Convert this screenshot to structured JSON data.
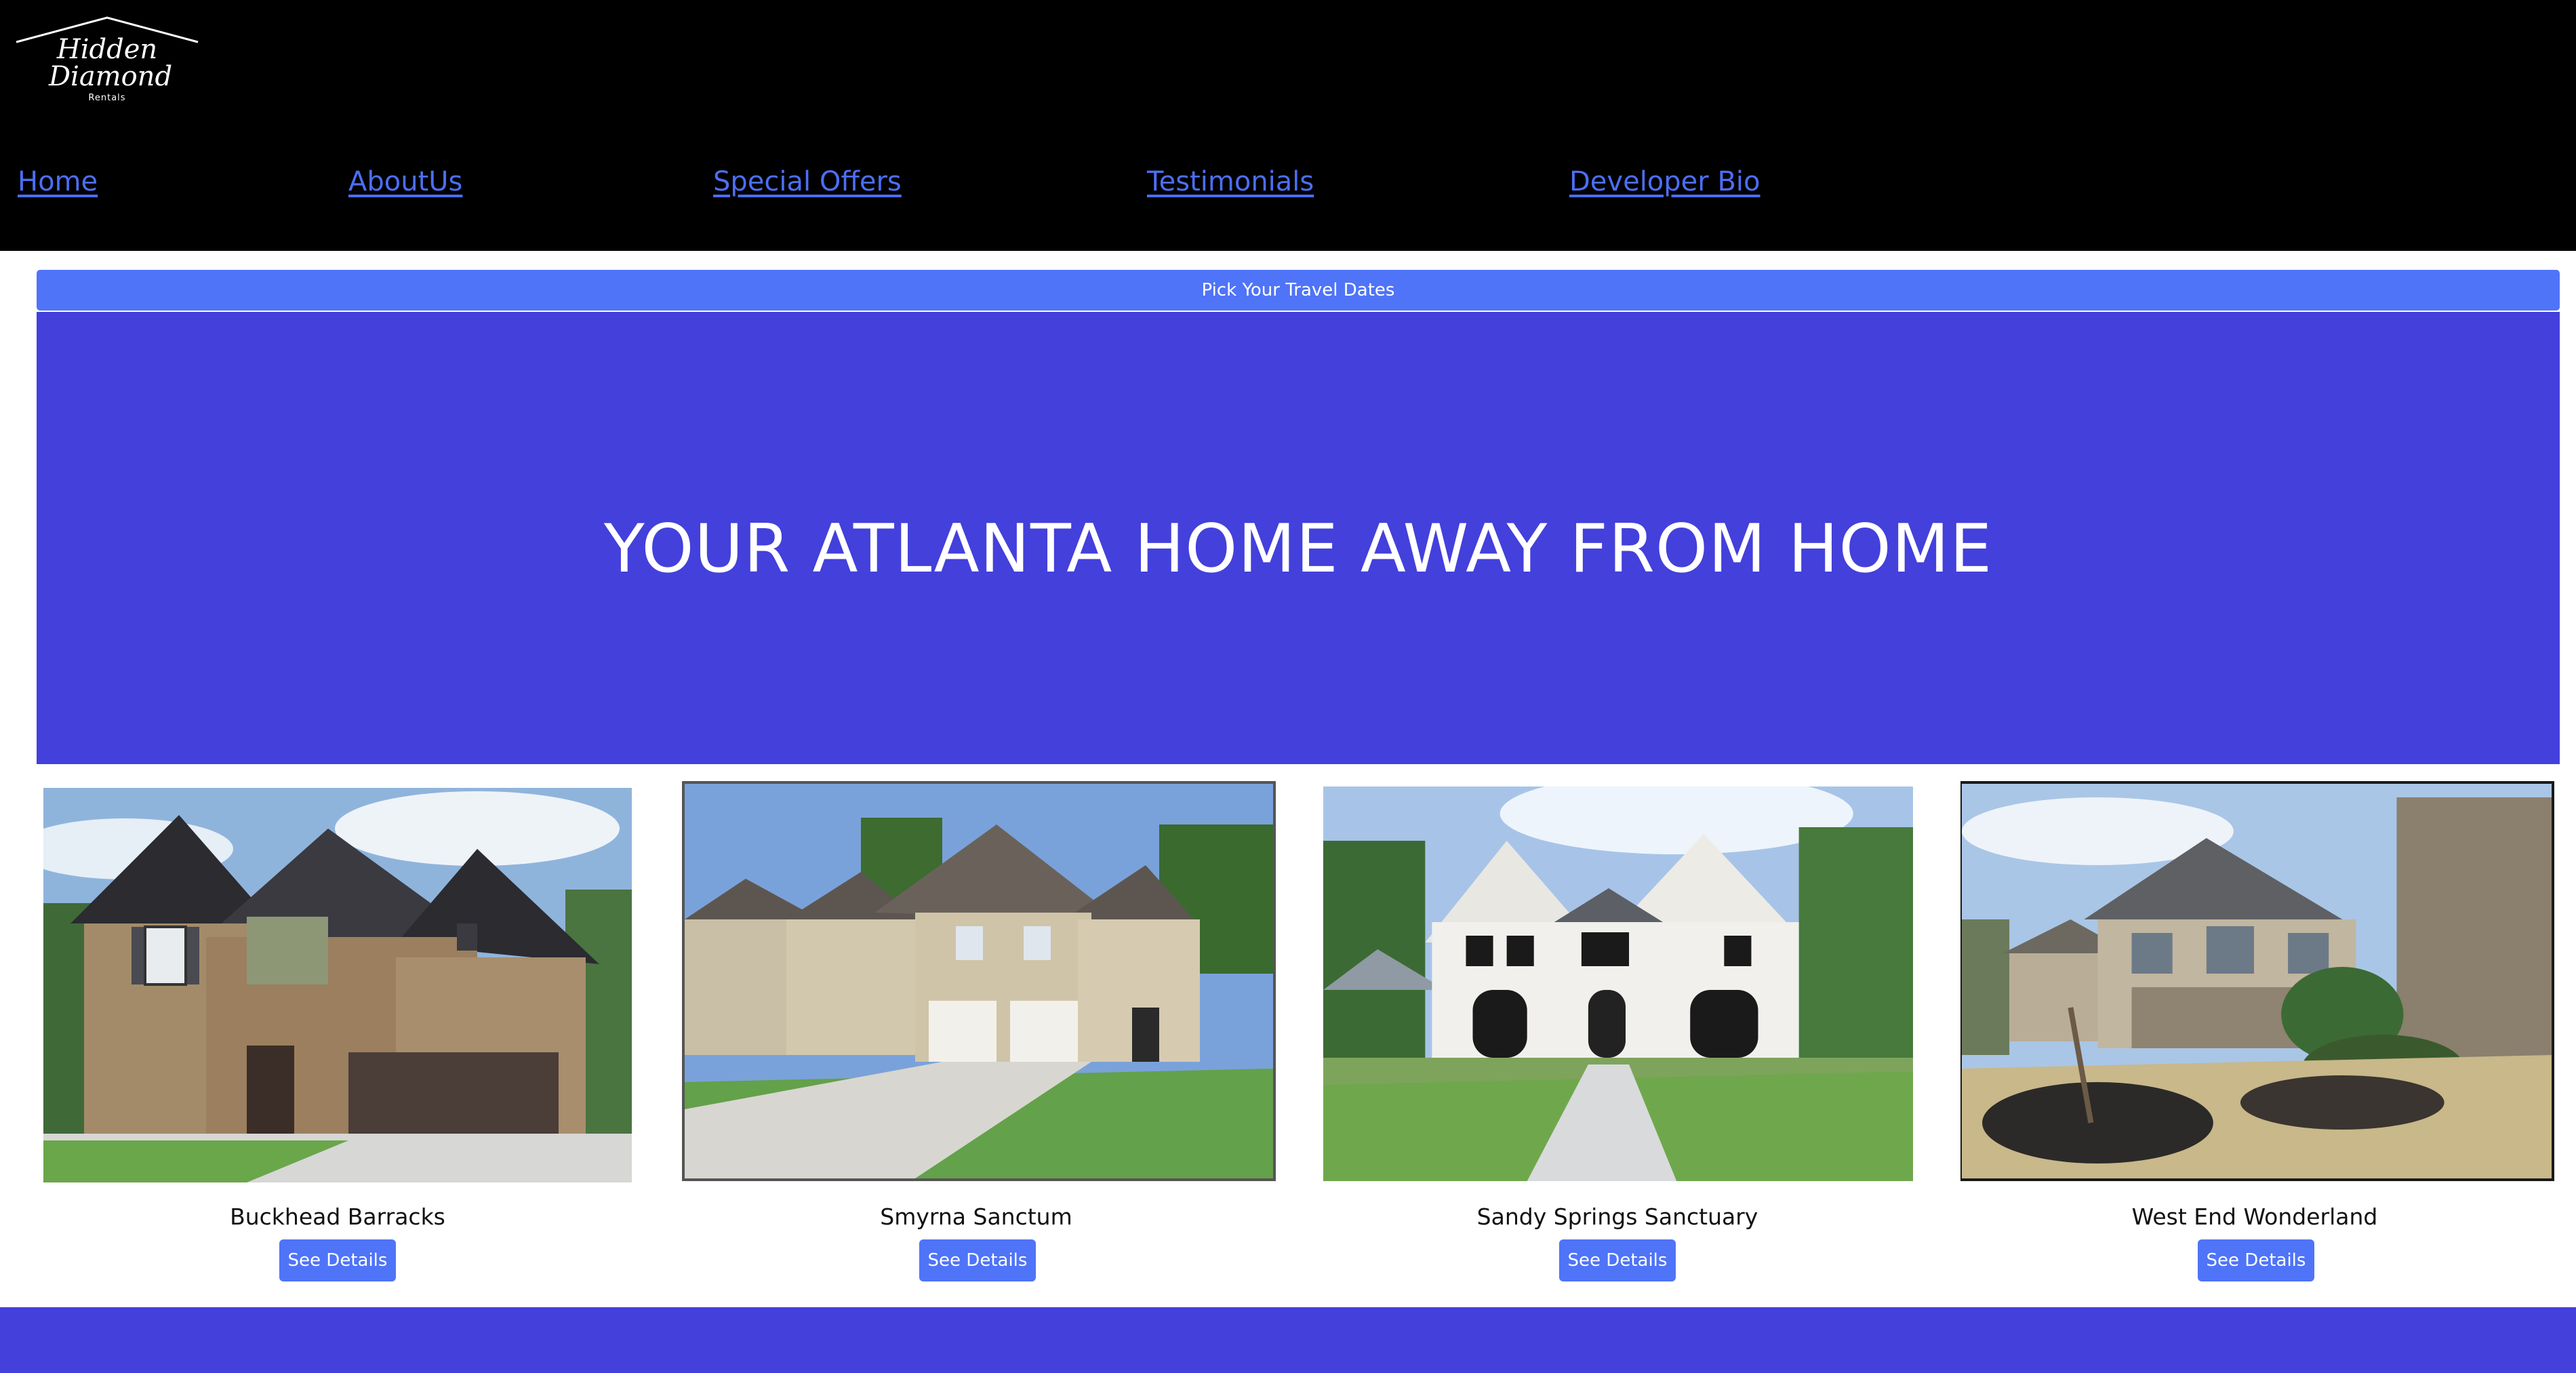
{
  "brand": {
    "logo_text_script": "Hidden Diamond",
    "logo_text_small": "Rentals"
  },
  "nav": {
    "items": [
      {
        "label": "Home"
      },
      {
        "label": "AboutUs"
      },
      {
        "label": "Special Offers"
      },
      {
        "label": "Testimonials"
      },
      {
        "label": "Developer Bio"
      }
    ],
    "link_color": "#4c6ef5"
  },
  "dates_bar": {
    "label": "Pick Your Travel Dates"
  },
  "hero": {
    "title": "YOUR ATLANTA HOME AWAY FROM HOME"
  },
  "properties": [
    {
      "name": "Buckhead Barracks",
      "button_label": "See Details",
      "image": "brick two-story house with dark garage door"
    },
    {
      "name": "Smyrna Sanctum",
      "button_label": "See Details",
      "image": "row of townhomes with white garage doors"
    },
    {
      "name": "Sandy Springs Sanctuary",
      "button_label": "See Details",
      "image": "white two-story house with black windows"
    },
    {
      "name": "West End Wonderland",
      "button_label": "See Details",
      "image": "craftsman house with landscaped front yard"
    }
  ],
  "colors": {
    "header_bg": "#000000",
    "accent": "#4f74f8",
    "hero_bg": "#4340dc",
    "footer_bg": "#4340dc"
  }
}
